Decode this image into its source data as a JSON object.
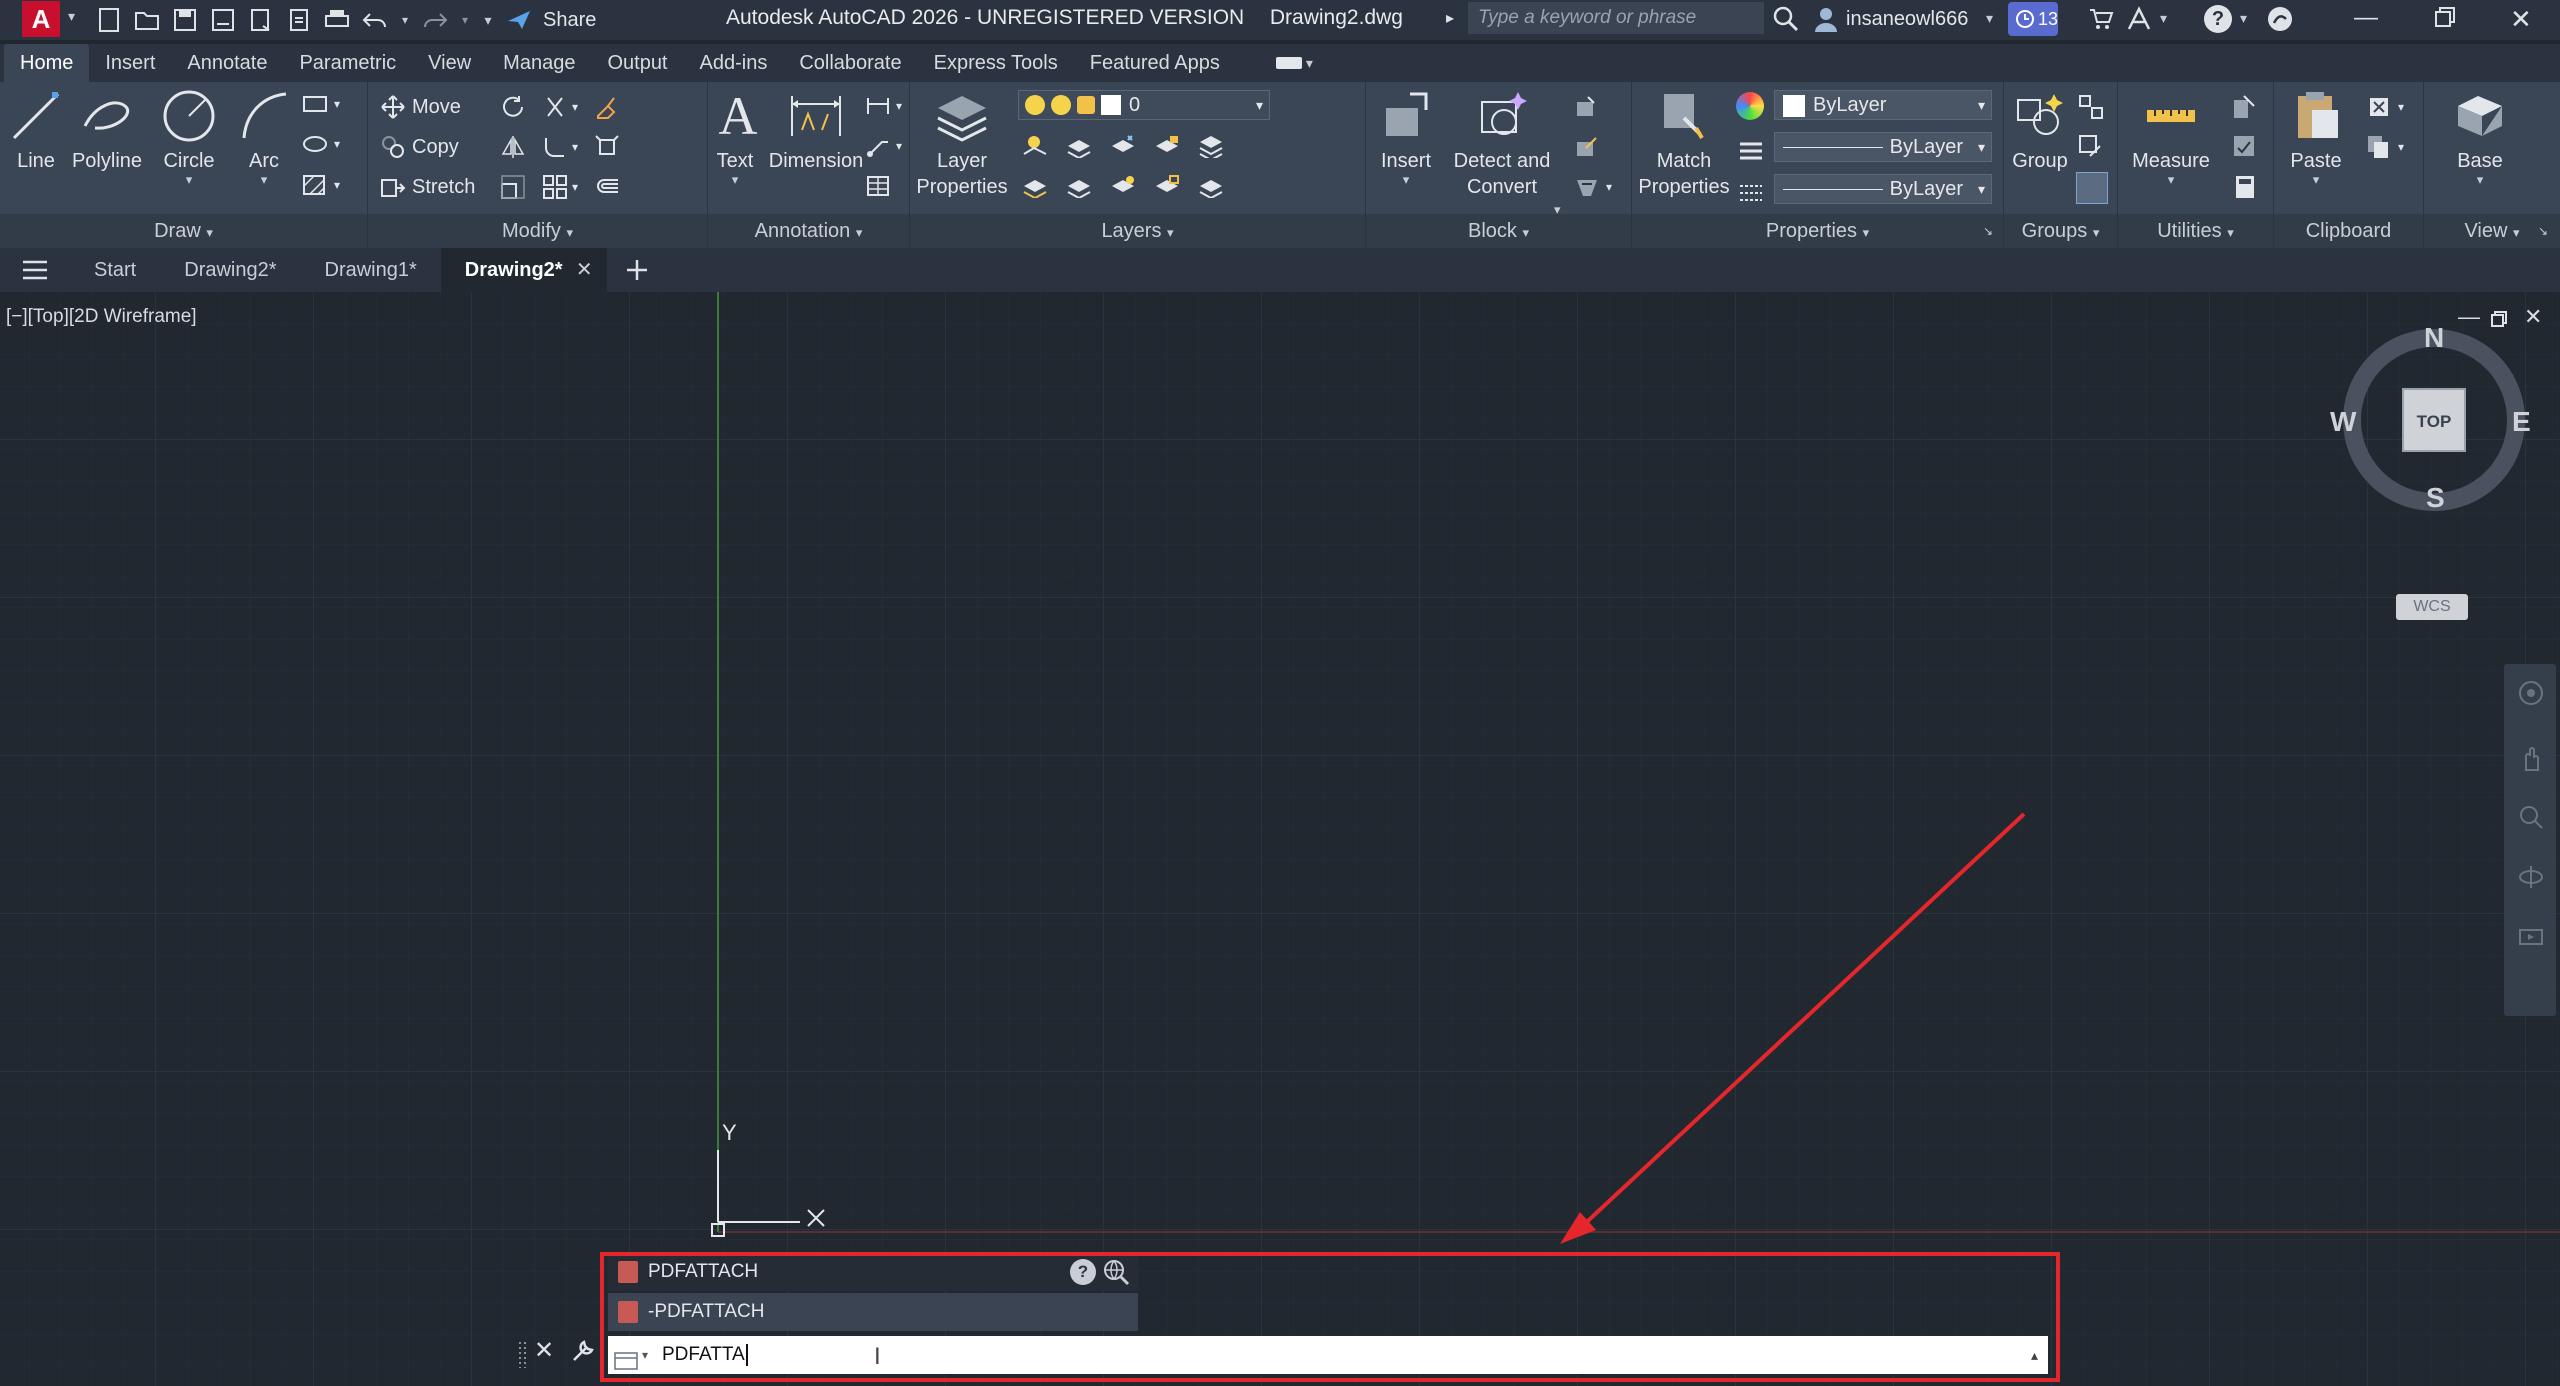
{
  "titlebar": {
    "logo": "A",
    "share_label": "Share",
    "title": "Autodesk AutoCAD 2026 - UNREGISTERED VERSION",
    "filename": "Drawing2.dwg",
    "search_placeholder": "Type a keyword or phrase",
    "username": "insaneowl666",
    "notification_count": "13"
  },
  "ribbon_tabs": [
    "Home",
    "Insert",
    "Annotate",
    "Parametric",
    "View",
    "Manage",
    "Output",
    "Add-ins",
    "Collaborate",
    "Express Tools",
    "Featured Apps"
  ],
  "ribbon": {
    "draw": {
      "line": "Line",
      "polyline": "Polyline",
      "circle": "Circle",
      "arc": "Arc",
      "panel": "Draw"
    },
    "modify": {
      "move": "Move",
      "copy": "Copy",
      "stretch": "Stretch",
      "panel": "Modify"
    },
    "annotation": {
      "text": "Text",
      "dimension": "Dimension",
      "panel": "Annotation"
    },
    "layers": {
      "layer_properties_1": "Layer",
      "layer_properties_2": "Properties",
      "current_layer": "0",
      "panel": "Layers"
    },
    "block": {
      "insert": "Insert",
      "detect_1": "Detect and",
      "detect_2": "Convert",
      "panel": "Block"
    },
    "properties": {
      "match_1": "Match",
      "match_2": "Properties",
      "color": "ByLayer",
      "linetype": "ByLayer",
      "lineweight": "ByLayer",
      "panel": "Properties"
    },
    "groups": {
      "group": "Group",
      "panel": "Groups"
    },
    "utilities": {
      "measure": "Measure",
      "panel": "Utilities"
    },
    "clipboard": {
      "paste": "Paste",
      "panel": "Clipboard"
    },
    "view": {
      "base": "Base",
      "panel": "View"
    }
  },
  "file_tabs": [
    "Start",
    "Drawing2*",
    "Drawing1*",
    "Drawing2*"
  ],
  "viewport": {
    "label": "[−][Top][2D Wireframe]",
    "viewcube": {
      "north": "N",
      "south": "S",
      "east": "E",
      "west": "W",
      "face": "TOP",
      "wcs": "WCS"
    },
    "ucs": {
      "x": "X",
      "y": "Y"
    }
  },
  "command": {
    "suggestions": [
      "PDFATTACH",
      "-PDFATTACH"
    ],
    "input_value": "PDFATTA"
  },
  "colors": {
    "annotation_red": "#e5262b",
    "background": "#212830",
    "ribbon": "#3a4555"
  }
}
